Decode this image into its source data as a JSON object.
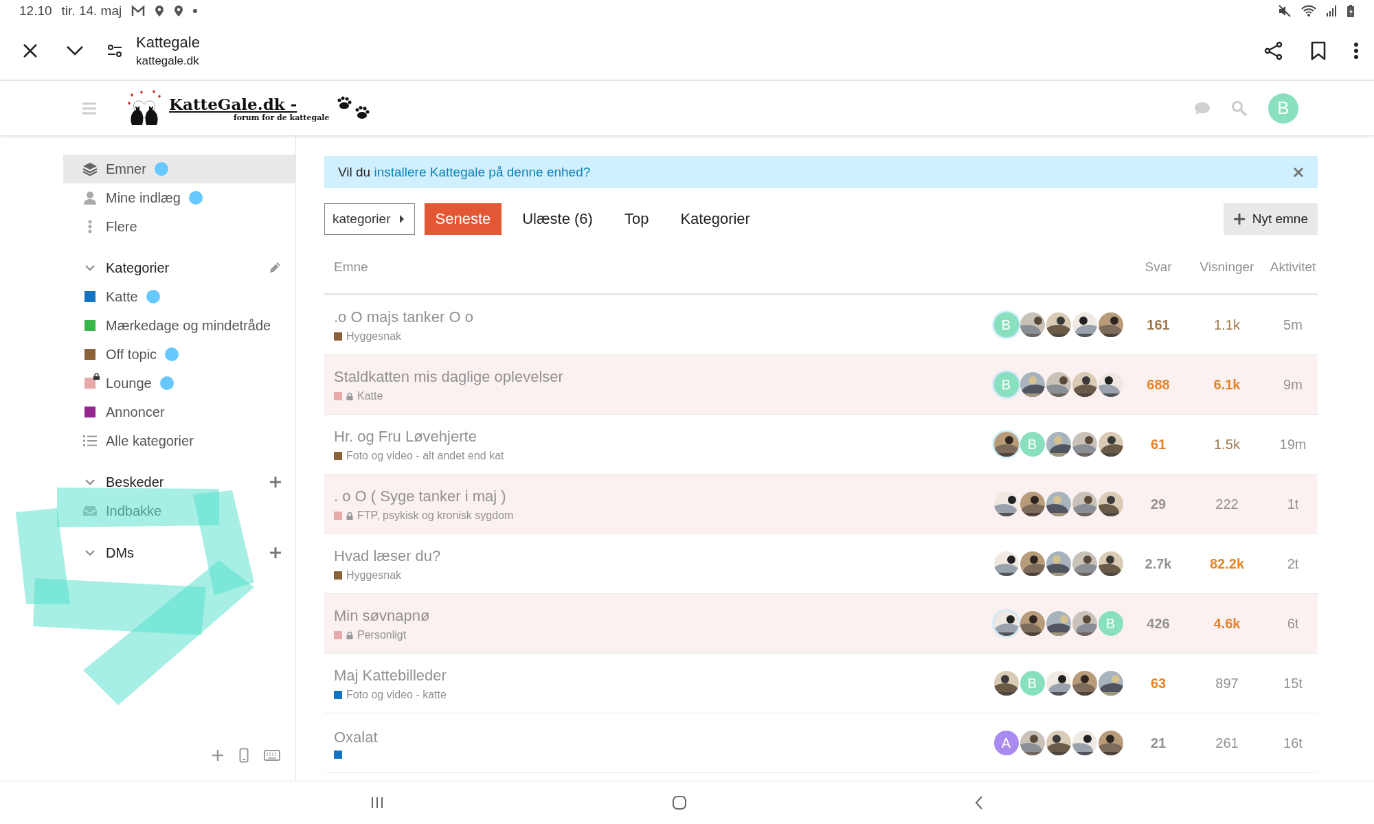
{
  "status_bar": {
    "time": "12.10",
    "date": "tir. 14. maj"
  },
  "browser": {
    "title": "Kattegale",
    "url": "kattegale.dk"
  },
  "site_header": {
    "logo_title": "KatteGale.dk -",
    "logo_tagline": "forum for de kattegale",
    "user_initial": "B"
  },
  "sidebar": {
    "nav": [
      {
        "label": "Emner",
        "selected": true,
        "unread": true
      },
      {
        "label": "Mine indlæg",
        "selected": false,
        "unread": true
      },
      {
        "label": "Flere",
        "selected": false,
        "unread": false
      }
    ],
    "categories_heading": "Kategorier",
    "categories": [
      {
        "label": "Katte",
        "color": "#1274c2",
        "locked": false,
        "unread": true
      },
      {
        "label": "Mærkedage og mindetråde",
        "color": "#3ab54a",
        "locked": false,
        "unread": false
      },
      {
        "label": "Off topic",
        "color": "#8c6238",
        "locked": false,
        "unread": true
      },
      {
        "label": "Lounge",
        "color": "#e7a9a9",
        "locked": true,
        "unread": true
      },
      {
        "label": "Annoncer",
        "color": "#92278f",
        "locked": false,
        "unread": false
      }
    ],
    "all_categories": "Alle kategorier",
    "messages_heading": "Beskeder",
    "inbox": "Indbakke",
    "dms_heading": "DMs"
  },
  "banner": {
    "text": "Vil du ",
    "link": "installere Kattegale på denne enhed?"
  },
  "nav": {
    "dropdown": "kategorier",
    "tabs": [
      {
        "label": "Seneste",
        "selected": true
      },
      {
        "label": "Ulæste (6)",
        "selected": false
      },
      {
        "label": "Top",
        "selected": false
      },
      {
        "label": "Kategorier",
        "selected": false
      }
    ],
    "new_topic": "Nyt emne"
  },
  "table": {
    "columns": [
      "Emne",
      "Svar",
      "Visninger",
      "Aktivitet"
    ],
    "rows": [
      {
        "title": ".o O majs tanker O o",
        "category": {
          "name": "Hyggesnak",
          "color": "#8c6238",
          "locked": false
        },
        "highlighted": false,
        "posters": [
          {
            "kind": "letter",
            "letter": "B",
            "color": "#88e0be",
            "latest": true
          },
          {
            "kind": "picture",
            "latest": false
          },
          {
            "kind": "picture",
            "latest": false
          },
          {
            "kind": "picture",
            "latest": false
          },
          {
            "kind": "picture",
            "latest": false
          }
        ],
        "replies": {
          "text": "161",
          "color": "#a0794c"
        },
        "views": {
          "text": "1.1k",
          "color": "#a0794c",
          "emphasized": false
        },
        "activity": "5m"
      },
      {
        "title": "Staldkatten mis daglige oplevelser",
        "category": {
          "name": "Katte",
          "color": "#e7a9a9",
          "locked": true
        },
        "highlighted": true,
        "posters": [
          {
            "kind": "letter",
            "letter": "B",
            "color": "#88e0be",
            "latest": true
          },
          {
            "kind": "picture",
            "latest": false
          },
          {
            "kind": "picture",
            "latest": false
          },
          {
            "kind": "picture",
            "latest": false
          },
          {
            "kind": "picture",
            "latest": false
          }
        ],
        "replies": {
          "text": "688",
          "color": "#e6842b"
        },
        "views": {
          "text": "6.1k",
          "color": "#e6842b",
          "emphasized": true
        },
        "activity": "9m"
      },
      {
        "title": "Hr. og Fru Løvehjerte",
        "category": {
          "name": "Foto og video - alt andet end kat",
          "color": "#8c6238",
          "locked": false
        },
        "highlighted": false,
        "posters": [
          {
            "kind": "picture",
            "latest": true
          },
          {
            "kind": "letter",
            "letter": "B",
            "color": "#88e0be",
            "latest": false
          },
          {
            "kind": "picture",
            "latest": false
          },
          {
            "kind": "picture",
            "latest": false
          },
          {
            "kind": "picture",
            "latest": false
          }
        ],
        "replies": {
          "text": "61",
          "color": "#e6842b"
        },
        "views": {
          "text": "1.5k",
          "color": "#a0794c",
          "emphasized": false
        },
        "activity": "19m"
      },
      {
        "title": ". o O ( Syge tanker i maj )",
        "category": {
          "name": "FTP, psykisk og kronisk sygdom",
          "color": "#e7a9a9",
          "locked": true
        },
        "highlighted": true,
        "posters": [
          {
            "kind": "picture",
            "latest": false
          },
          {
            "kind": "picture",
            "latest": false
          },
          {
            "kind": "picture",
            "latest": false
          },
          {
            "kind": "picture",
            "latest": false
          },
          {
            "kind": "picture",
            "latest": false
          }
        ],
        "replies": {
          "text": "29",
          "color": "#919191"
        },
        "views": {
          "text": "222",
          "color": "#919191",
          "emphasized": false
        },
        "activity": "1t"
      },
      {
        "title": "Hvad læser du?",
        "category": {
          "name": "Hyggesnak",
          "color": "#8c6238",
          "locked": false
        },
        "highlighted": false,
        "posters": [
          {
            "kind": "picture",
            "latest": false
          },
          {
            "kind": "picture",
            "latest": false
          },
          {
            "kind": "picture",
            "latest": false
          },
          {
            "kind": "picture",
            "latest": false
          },
          {
            "kind": "picture",
            "latest": false
          }
        ],
        "replies": {
          "text": "2.7k",
          "color": "#919191"
        },
        "views": {
          "text": "82.2k",
          "color": "#e6842b",
          "emphasized": true
        },
        "activity": "2t"
      },
      {
        "title": "Min søvnapnø",
        "category": {
          "name": "Personligt",
          "color": "#e7a9a9",
          "locked": true
        },
        "highlighted": true,
        "posters": [
          {
            "kind": "picture",
            "latest": true
          },
          {
            "kind": "picture",
            "latest": false
          },
          {
            "kind": "picture",
            "latest": false
          },
          {
            "kind": "picture",
            "latest": false
          },
          {
            "kind": "letter",
            "letter": "B",
            "color": "#88e0be",
            "latest": false
          }
        ],
        "replies": {
          "text": "426",
          "color": "#919191"
        },
        "views": {
          "text": "4.6k",
          "color": "#e6842b",
          "emphasized": true
        },
        "activity": "6t"
      },
      {
        "title": "Maj Kattebilleder",
        "category": {
          "name": "Foto og video - katte",
          "color": "#1274c2",
          "locked": false
        },
        "highlighted": false,
        "posters": [
          {
            "kind": "picture",
            "latest": false
          },
          {
            "kind": "letter",
            "letter": "B",
            "color": "#88e0be",
            "latest": false
          },
          {
            "kind": "picture",
            "latest": false
          },
          {
            "kind": "picture",
            "latest": false
          },
          {
            "kind": "picture",
            "latest": false
          }
        ],
        "replies": {
          "text": "63",
          "color": "#e6842b"
        },
        "views": {
          "text": "897",
          "color": "#919191",
          "emphasized": false
        },
        "activity": "15t"
      },
      {
        "title": "Oxalat",
        "category": {
          "color": "#1274c2",
          "locked": false
        },
        "highlighted": false,
        "posters": [
          {
            "kind": "letter",
            "letter": "A",
            "color": "#a98af0",
            "latest": false
          },
          {
            "kind": "picture",
            "latest": false
          },
          {
            "kind": "picture",
            "latest": false
          },
          {
            "kind": "picture",
            "latest": false
          },
          {
            "kind": "picture",
            "latest": false
          }
        ],
        "replies": {
          "text": "21",
          "color": "#919191"
        },
        "views": {
          "text": "261",
          "color": "#919191",
          "emphasized": false
        },
        "activity": "16t"
      }
    ]
  }
}
